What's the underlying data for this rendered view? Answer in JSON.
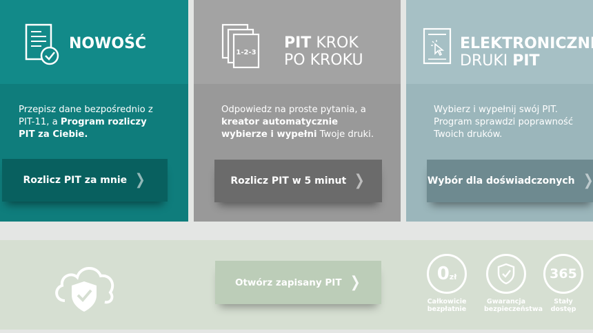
{
  "cards": [
    {
      "title": "NOWOŚĆ",
      "desc_pre": "Przepisz dane bezpośrednio z PIT-11, a ",
      "desc_bold": "Program rozliczy PIT za Ciebie.",
      "button": "Rozlicz PIT za mnie",
      "icon": "document-check-icon"
    },
    {
      "title_bold": "PIT",
      "title_rest1": "KROK",
      "title_rest2": "PO KROKU",
      "icon_text": "1-2-3",
      "desc_pre": "Odpowiedz na proste pytania, a ",
      "desc_bold": "kreator automatycznie wybierze i wypełni",
      "desc_post": " Twoje druki.",
      "button": "Rozlicz PIT w 5 minut",
      "icon": "stacked-documents-icon"
    },
    {
      "title_line1": "ELEKTRONICZNE",
      "title_line2_pre": "DRUKI ",
      "title_line2_bold": "PIT",
      "desc": "Wybierz i wypełnij swój PIT. Program sprawdzi poprawność Twoich druków.",
      "button": "Wybór dla doświadczonych",
      "icon": "form-cursor-icon"
    }
  ],
  "bottom": {
    "open_button": "Otwórz zapisany PIT",
    "badges": [
      {
        "value": "0",
        "unit": "zł",
        "label": "Całkowicie\nbezpłatnie"
      },
      {
        "label": "Gwarancja\nbezpieczeństwa",
        "icon": "shield-check-icon"
      },
      {
        "value": "365",
        "label": "Stały\ndostęp"
      }
    ]
  },
  "colors": {
    "teal": "#128a89",
    "teal_button": "#08605f",
    "gray": "#a3a3a3",
    "gray_button": "#6b6b6b",
    "blue_gray": "#a6c0c5",
    "blue_gray_button": "#6e8a90",
    "bottom_bg": "#d6dfd2"
  }
}
